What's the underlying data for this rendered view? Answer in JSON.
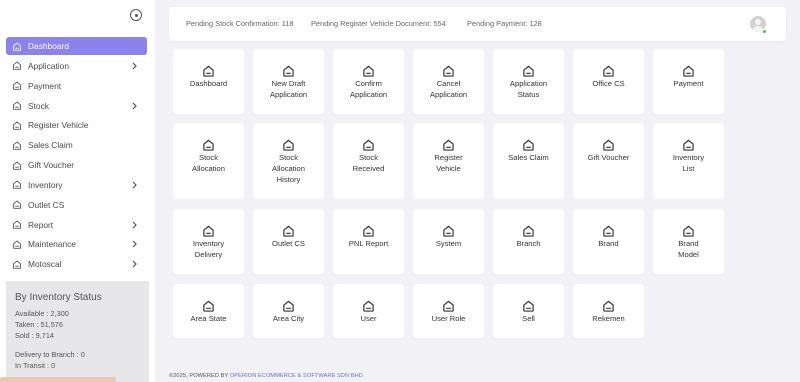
{
  "sidebar": {
    "items": [
      {
        "label": "Dashboard",
        "active": true,
        "has_submenu": false
      },
      {
        "label": "Application",
        "active": false,
        "has_submenu": true
      },
      {
        "label": "Payment",
        "active": false,
        "has_submenu": false
      },
      {
        "label": "Stock",
        "active": false,
        "has_submenu": true
      },
      {
        "label": "Register Vehicle",
        "active": false,
        "has_submenu": false
      },
      {
        "label": "Sales Claim",
        "active": false,
        "has_submenu": false
      },
      {
        "label": "Gift Voucher",
        "active": false,
        "has_submenu": false
      },
      {
        "label": "Inventory",
        "active": false,
        "has_submenu": true
      },
      {
        "label": "Outlet CS",
        "active": false,
        "has_submenu": false
      },
      {
        "label": "Report",
        "active": false,
        "has_submenu": true
      },
      {
        "label": "Maintenance",
        "active": false,
        "has_submenu": true
      },
      {
        "label": "Motoscal",
        "active": false,
        "has_submenu": true
      }
    ],
    "inventory_status": {
      "title": "By Inventory Status",
      "available": "Available : 2,300",
      "taken": "Taken : 51,576",
      "sold": "Sold : 9,714",
      "delivery_to_branch": "Delivery to Branch : 0",
      "in_transit": "In Transit : 0"
    }
  },
  "header": {
    "pending_stock_confirmation": "Pending Stock Confirmation: 118",
    "pending_register_vehicle_document": "Pending Register Vehicle Document: 554",
    "pending_payment": "Pending Payment: 128"
  },
  "tiles": [
    [
      "Dashboard"
    ],
    [
      "New Draft",
      "Application"
    ],
    [
      "Confirm",
      "Application"
    ],
    [
      "Cancel",
      "Application"
    ],
    [
      "Application",
      "Status"
    ],
    [
      "Office CS"
    ],
    [
      "Payment"
    ],
    [
      "Stock",
      "Allocation"
    ],
    [
      "Stock",
      "Allocation",
      "History"
    ],
    [
      "Stock",
      "Received"
    ],
    [
      "Register",
      "Vehicle"
    ],
    [
      "Sales Claim"
    ],
    [
      "Gift Voucher"
    ],
    [
      "Inventory",
      "List"
    ],
    [
      "Inventory",
      "Delivery"
    ],
    [
      "Outlet CS"
    ],
    [
      "PNL Report"
    ],
    [
      "System"
    ],
    [
      "Branch"
    ],
    [
      "Brand"
    ],
    [
      "Brand",
      "Model"
    ],
    [
      "Area State"
    ],
    [
      "Area City"
    ],
    [
      "User"
    ],
    [
      "User Role"
    ],
    [
      "Sell"
    ],
    [
      "Rekemen"
    ]
  ],
  "footer": {
    "prefix": "©2025, POWERED BY ",
    "company": "OPERION ECOMMERCE & SOFTWARE SDN BHD"
  }
}
